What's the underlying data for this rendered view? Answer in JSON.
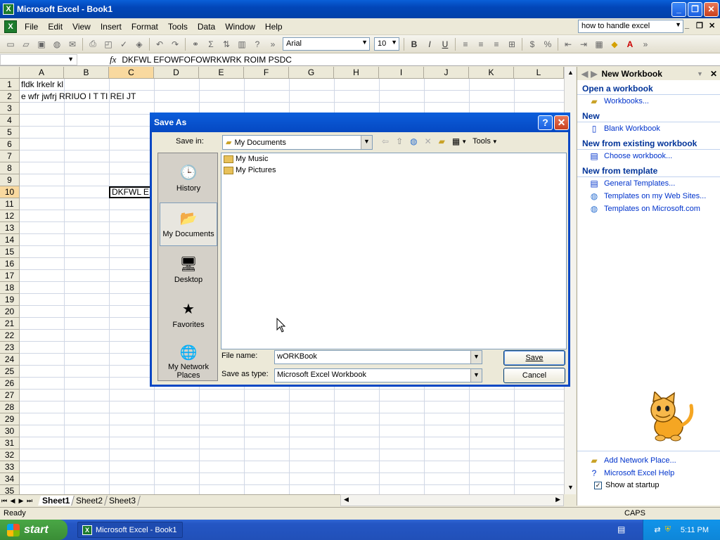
{
  "window": {
    "title": "Microsoft Excel - Book1"
  },
  "menu": [
    "File",
    "Edit",
    "View",
    "Insert",
    "Format",
    "Tools",
    "Data",
    "Window",
    "Help"
  ],
  "help_box": {
    "value": "how to handle excel"
  },
  "toolbar": {
    "font": "Arial",
    "size": "10"
  },
  "formula": {
    "fx": "fx",
    "value": "DKFWL EFOWFOFOWRKWRK ROIM   PSDC"
  },
  "columns": [
    "A",
    "B",
    "C",
    "D",
    "E",
    "F",
    "G",
    "H",
    "I",
    "J",
    "K",
    "L"
  ],
  "rows": [
    "1",
    "2",
    "3",
    "4",
    "5",
    "6",
    "7",
    "8",
    "9",
    "10",
    "11",
    "12",
    "13",
    "14",
    "15",
    "16",
    "17",
    "18",
    "19",
    "20",
    "21",
    "22",
    "23",
    "24",
    "25",
    "26",
    "27",
    "28",
    "29",
    "30",
    "31",
    "32",
    "33",
    "34",
    "35"
  ],
  "cells": {
    "a1": "fldk lrkelr kl",
    "a2": "e wfr jwfrj RRIUO I T TI REI JT",
    "c10": "DKFWL E"
  },
  "sheets": [
    "Sheet1",
    "Sheet2",
    "Sheet3"
  ],
  "status": {
    "ready": "Ready",
    "caps": "CAPS"
  },
  "taskpane": {
    "title": "New Workbook",
    "sections": [
      {
        "heading": "Open a workbook",
        "links": [
          "Workbooks..."
        ]
      },
      {
        "heading": "New",
        "links": [
          "Blank Workbook"
        ]
      },
      {
        "heading": "New from existing workbook",
        "links": [
          "Choose workbook..."
        ]
      },
      {
        "heading": "New from template",
        "links": [
          "General Templates...",
          "Templates on my Web Sites...",
          "Templates on Microsoft.com"
        ]
      }
    ],
    "footer": {
      "add_network": "Add Network Place...",
      "help": "Microsoft Excel Help",
      "show_startup": "Show at startup"
    }
  },
  "dialog": {
    "title": "Save As",
    "save_in_label": "Save in:",
    "save_in_value": "My Documents",
    "tools_label": "Tools",
    "places": [
      "History",
      "My Documents",
      "Desktop",
      "Favorites",
      "My Network Places"
    ],
    "files": [
      "My Music",
      "My Pictures"
    ],
    "file_name_label": "File name:",
    "file_name_value": "wORKBook",
    "save_type_label": "Save as type:",
    "save_type_value": "Microsoft Excel Workbook",
    "save_button": "Save",
    "cancel_button": "Cancel"
  },
  "taskbar": {
    "start": "start",
    "item": "Microsoft Excel - Book1",
    "clock": "5:11 PM"
  }
}
